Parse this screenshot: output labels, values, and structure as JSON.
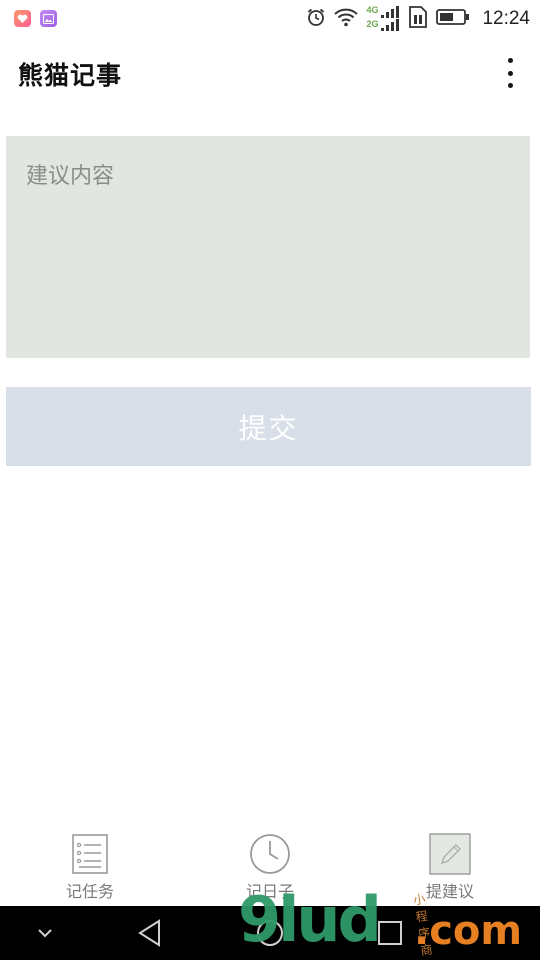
{
  "status_bar": {
    "time": "12:24",
    "network_4g": "4G",
    "network_2g": "2G",
    "icons": [
      "app-notification-icon",
      "gallery-icon",
      "alarm-icon",
      "wifi-icon",
      "signal-icon",
      "sim-icon",
      "battery-icon"
    ]
  },
  "app_bar": {
    "title": "熊猫记事",
    "menu_icon": "overflow-menu-icon"
  },
  "form": {
    "placeholder": "建议内容",
    "value": "",
    "submit_label": "提交",
    "colors": {
      "input_bg": "#e2e6e0",
      "button_bg": "#d8dfe8",
      "button_text": "#ffffff"
    }
  },
  "tabs": [
    {
      "label": "记任务",
      "icon": "task-list-icon"
    },
    {
      "label": "记日子",
      "icon": "clock-icon"
    },
    {
      "label": "提建议",
      "icon": "pencil-icon",
      "selected": true
    }
  ],
  "nav_bar": {
    "icons": [
      "chevron-down-icon",
      "back-icon",
      "home-icon",
      "recents-icon"
    ]
  },
  "watermark": {
    "text": "9lud",
    "suffix": ".com",
    "small_text": "小程序商店"
  }
}
